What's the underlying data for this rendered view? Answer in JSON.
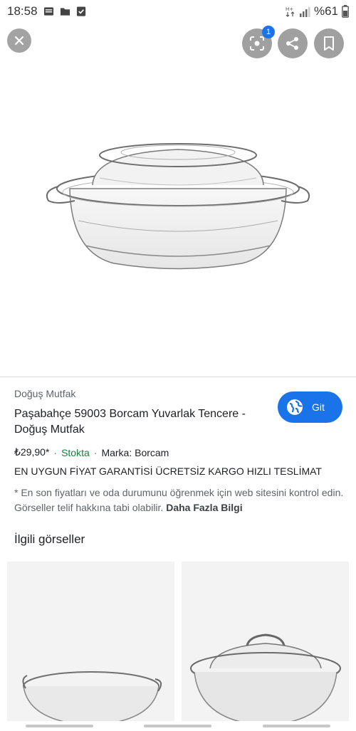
{
  "status_bar": {
    "time": "18:58",
    "battery": "%61",
    "icons": [
      "news-icon",
      "folder-icon",
      "check-box-icon",
      "data-arrows-icon",
      "signal-icon"
    ]
  },
  "controls": {
    "lens_badge": "1"
  },
  "product": {
    "source": "Doğuş Mutfak",
    "title": "Paşabahçe 59003 Borcam Yuvarlak Tencere - Doğuş Mutfak",
    "price": "₺29,90*",
    "stock": "Stokta",
    "brand": "Marka: Borcam",
    "promo": "EN UYGUN FİYAT GARANTİSİ ÜCRETSİZ KARGO HIZLI TESLİMAT",
    "note": "* En son fiyatları ve oda durumunu öğrenmek için web sitesini kontrol edin. Görseller telif hakkına tabi olabilir.",
    "more_link": "Daha Fazla Bilgi"
  },
  "visit_button": {
    "label": "Git"
  },
  "related": {
    "title": "İlgili görseller"
  },
  "colors": {
    "accent": "#1a73e8",
    "stock_green": "#188038"
  }
}
